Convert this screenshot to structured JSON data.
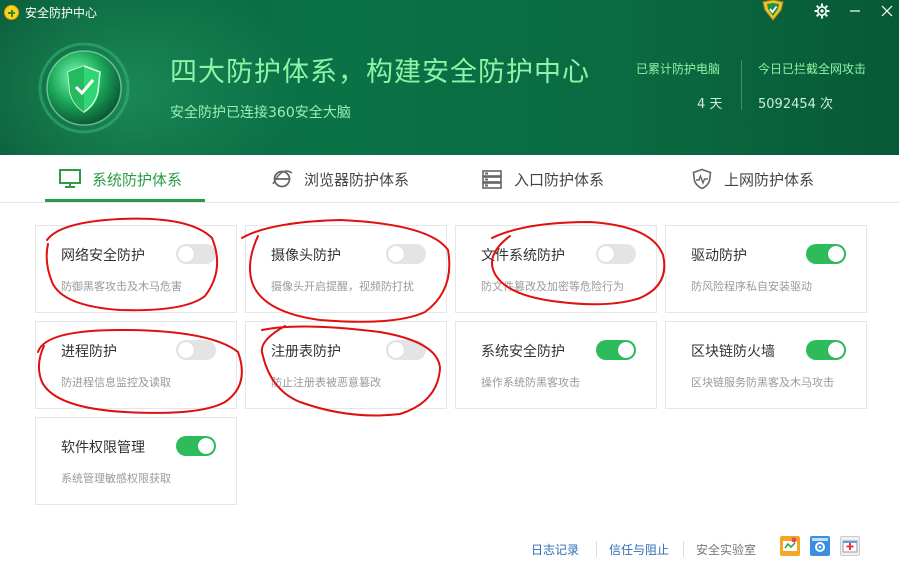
{
  "app": {
    "title": "安全防护中心"
  },
  "header": {
    "headline": "四大防护体系，构建安全防护中心",
    "subline": "安全防护已连接360安全大脑",
    "stats": [
      {
        "label": "已累计防护电脑",
        "value": "4 天"
      },
      {
        "label": "今日已拦截全网攻击",
        "value": "5092454 次"
      }
    ]
  },
  "tabs": [
    {
      "label": "系统防护体系",
      "icon": "monitor-icon",
      "active": true
    },
    {
      "label": "浏览器防护体系",
      "icon": "ie-icon",
      "active": false
    },
    {
      "label": "入口防护体系",
      "icon": "entry-icon",
      "active": false
    },
    {
      "label": "上网防护体系",
      "icon": "net-shield-icon",
      "active": false
    }
  ],
  "cards": [
    {
      "title": "网络安全防护",
      "desc": "防御黑客攻击及木马危害",
      "on": false
    },
    {
      "title": "摄像头防护",
      "desc": "摄像头开启提醒，视频防打扰",
      "on": false
    },
    {
      "title": "文件系统防护",
      "desc": "防文件篡改及加密等危险行为",
      "on": false
    },
    {
      "title": "驱动防护",
      "desc": "防风险程序私自安装驱动",
      "on": true
    },
    {
      "title": "进程防护",
      "desc": "防进程信息监控及读取",
      "on": false
    },
    {
      "title": "注册表防护",
      "desc": "防止注册表被恶意篡改",
      "on": false
    },
    {
      "title": "系统安全防护",
      "desc": "操作系统防黑客攻击",
      "on": true
    },
    {
      "title": "区块链防火墙",
      "desc": "区块链服务防黑客及木马攻击",
      "on": true
    },
    {
      "title": "软件权限管理",
      "desc": "系统管理敏感权限获取",
      "on": true
    }
  ],
  "footer": {
    "links": [
      "日志记录",
      "信任与阻止",
      "安全实验室"
    ]
  },
  "colors": {
    "accent": "#2a9c48",
    "toggle_on": "#2dbb5b",
    "header_bg": "#0b7247",
    "annotation": "#e01010"
  }
}
